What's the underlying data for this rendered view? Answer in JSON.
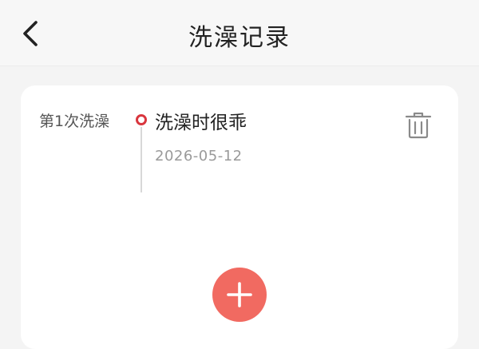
{
  "header": {
    "title": "洗澡记录",
    "back_icon": "chevron-left-icon"
  },
  "record": {
    "label": "第1次洗澡",
    "note": "洗澡时很乖",
    "date": "2026-05-12",
    "delete_icon": "trash-icon"
  },
  "actions": {
    "add_icon": "plus-icon"
  },
  "colors": {
    "accent": "#f16a61",
    "timeline_dot": "#d9363e"
  }
}
